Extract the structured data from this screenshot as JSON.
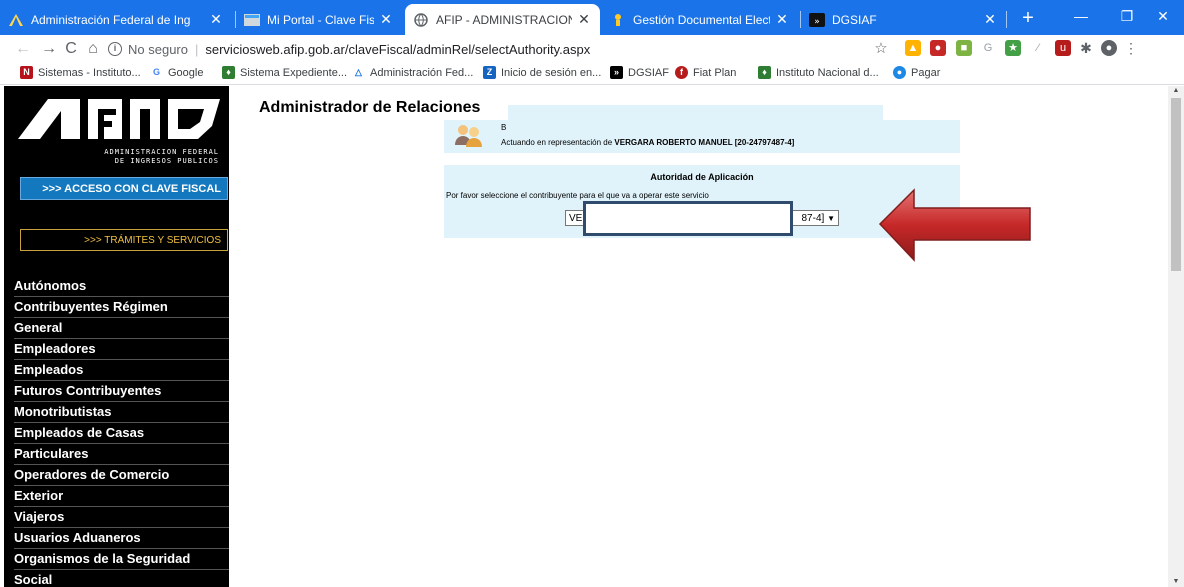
{
  "browser": {
    "tabs": [
      {
        "label": "Administración Federal de Ing",
        "icon": "afip-icon"
      },
      {
        "label": "Mi Portal - Clave Fiscal",
        "icon": "portal-icon"
      },
      {
        "label": "AFIP - ADMINISTRACION FEDE",
        "icon": "globe-icon"
      },
      {
        "label": "Gestión Documental Electrónic",
        "icon": "gde-icon"
      },
      {
        "label": "DGSIAF",
        "icon": "dgsiaf-icon"
      }
    ],
    "active_tab_index": 2,
    "new_tab": "+",
    "security_label": "No seguro",
    "url": "serviciosweb.afip.gob.ar/claveFiscal/adminRel/selectAuthority.aspx",
    "bookmarks": [
      {
        "label": "Sistemas - Instituto...",
        "icon": "inv-icon",
        "color": "#b5121b"
      },
      {
        "label": "Google",
        "icon": "google-icon",
        "color": "#4285f4"
      },
      {
        "label": "Sistema Expediente...",
        "icon": "expediente-icon",
        "color": "#2e7d32"
      },
      {
        "label": "Administración Fed...",
        "icon": "afip-icon",
        "color": "#1a73e8"
      },
      {
        "label": "Inicio de sesión en...",
        "icon": "z-icon",
        "color": "#1565c0"
      },
      {
        "label": "DGSIAF",
        "icon": "dgsiaf-icon",
        "color": "#000000"
      },
      {
        "label": "Fiat Plan",
        "icon": "fiat-icon",
        "color": "#b71c1c"
      },
      {
        "label": "Instituto Nacional d...",
        "icon": "instituto-icon",
        "color": "#2e7d32"
      },
      {
        "label": "Pagar",
        "icon": "pagar-icon",
        "color": "#1e88e5"
      }
    ]
  },
  "sidebar": {
    "logo_text": "AFIP",
    "logo_subtitle_1": "ADMINISTRACION FEDERAL",
    "logo_subtitle_2": "DE INGRESOS PUBLICOS",
    "acceso_button": ">>> ACCESO CON CLAVE FISCAL",
    "tramites_button": ">>> TRÁMITES Y SERVICIOS",
    "menu": [
      [
        "Autónomos"
      ],
      [
        "Contribuyentes Régimen",
        "General"
      ],
      [
        "Empleadores"
      ],
      [
        "Empleados"
      ],
      [
        "Futuros Contribuyentes"
      ],
      [
        "Monotributistas"
      ],
      [
        "Empleados de Casas",
        "Particulares"
      ],
      [
        "Operadores de Comercio",
        "Exterior"
      ],
      [
        "Viajeros"
      ],
      [
        "Usuarios Aduaneros"
      ],
      [
        "Organismos de la Seguridad",
        "Social"
      ]
    ]
  },
  "main": {
    "title": "Administrador de Relaciones",
    "user_initial": "B",
    "representation_prefix": "Actuando en representación de ",
    "representation_name": "VERGARA ROBERTO MANUEL [20-24797487-4]",
    "auth_title": "Autoridad de Aplicación",
    "auth_prompt": "Por favor seleccione el contribuyente para el que va a operar este servicio",
    "select_value_start": "VE",
    "select_value_end": "87-4]"
  }
}
